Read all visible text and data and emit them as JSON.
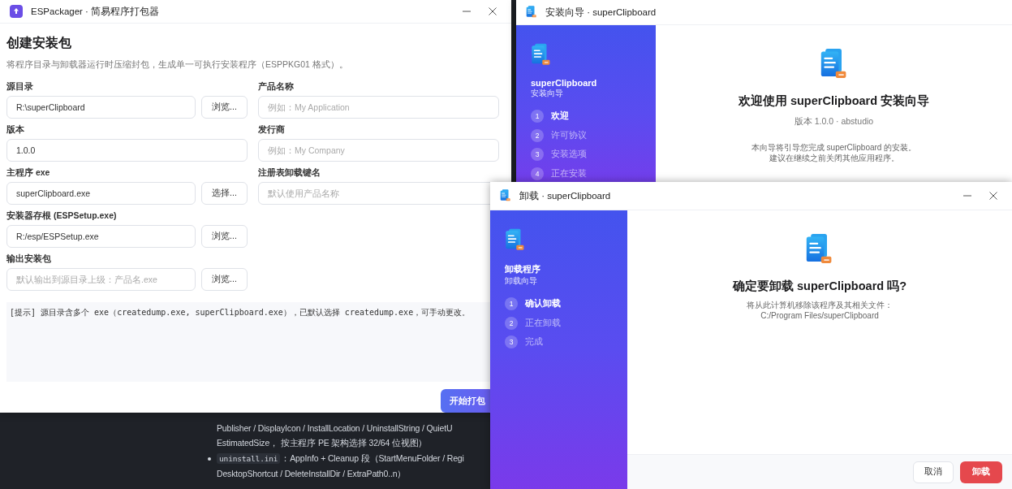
{
  "packager_window": {
    "title": "ESPackager · 简易程序打包器",
    "heading": "创建安装包",
    "description": "将程序目录与卸载器运行时压缩封包，生成单一可执行安装程序（ESPPKG01 格式）。",
    "left_column": [
      {
        "label": "源目录",
        "value": "R:\\superClipboard",
        "button": "浏览..."
      },
      {
        "label": "版本",
        "value": "1.0.0"
      },
      {
        "label": "主程序 exe",
        "value": "superClipboard.exe",
        "button": "选择..."
      },
      {
        "label": "安装器存根 (ESPSetup.exe)",
        "value": "R:/esp/ESPSetup.exe",
        "button": "浏览..."
      },
      {
        "label": "输出安装包",
        "placeholder": "默认输出到源目录上级：产品名.exe",
        "button": "浏览..."
      }
    ],
    "right_column": [
      {
        "label": "产品名称",
        "placeholder": "例如：My Application"
      },
      {
        "label": "发行商",
        "placeholder": "例如：My Company"
      },
      {
        "label": "注册表卸载键名",
        "placeholder": "默认使用产品名称"
      }
    ],
    "log": "[提示] 源目录含多个 exe（createdump.exe, superClipboard.exe），已默认选择 createdump.exe，可手动更改。",
    "primary_button": "开始打包"
  },
  "background_document": {
    "lines": [
      {
        "kind": "text",
        "text": "Publisher / DisplayIcon / InstallLocation / UninstallString / QuietU"
      },
      {
        "kind": "text",
        "text": "EstimatedSize， 按主程序 PE 架构选择 32/64 位视图）"
      },
      {
        "kind": "bullet",
        "code": "uninstall.ini",
        "text": "：AppInfo + Cleanup 段（StartMenuFolder / Regi"
      },
      {
        "kind": "text",
        "text": "DesktopShortcut / DeleteInstallDir / ExtraPath0..n）"
      }
    ]
  },
  "installer_window": {
    "title": "安装向导 · superClipboard",
    "sidebar": {
      "app_name": "superClipboard",
      "subtitle": "安装向导",
      "steps": [
        {
          "number": "1",
          "label": "欢迎",
          "selected": true
        },
        {
          "number": "2",
          "label": "许可协议",
          "selected": false
        },
        {
          "number": "3",
          "label": "安装选项",
          "selected": false
        },
        {
          "number": "4",
          "label": "正在安装",
          "selected": false
        }
      ]
    },
    "heading": "欢迎使用 superClipboard 安装向导",
    "subheading": "版本 1.0.0 · abstudio",
    "body_lines": [
      "本向导将引导您完成 superClipboard 的安装。",
      "建议在继续之前关闭其他应用程序。"
    ]
  },
  "uninstaller_window": {
    "title": "卸载 · superClipboard",
    "sidebar": {
      "app_name": "卸载程序",
      "subtitle": "卸载向导",
      "steps": [
        {
          "number": "1",
          "label": "确认卸载",
          "selected": true
        },
        {
          "number": "2",
          "label": "正在卸载",
          "selected": false
        },
        {
          "number": "3",
          "label": "完成",
          "selected": false
        }
      ]
    },
    "heading": "确定要卸载 superClipboard 吗?",
    "body_lines": [
      "将从此计算机移除该程序及其相关文件：",
      "C:/Program Files/superClipboard"
    ],
    "buttons": [
      {
        "label": "取消",
        "kind": "secondary"
      },
      {
        "label": "卸载",
        "kind": "danger"
      }
    ]
  }
}
